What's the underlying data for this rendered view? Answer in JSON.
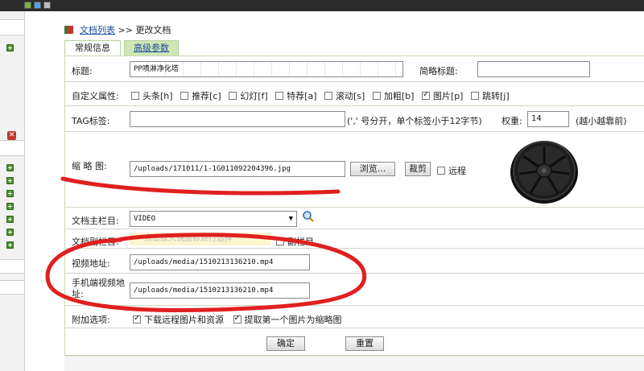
{
  "breadcrumb": {
    "link": "文档列表",
    "separator": ">>",
    "current": "更改文档"
  },
  "tabs": [
    {
      "label": "常规信息"
    },
    {
      "label": "高级参数"
    }
  ],
  "form": {
    "title": {
      "label": "标题:",
      "value": "PP喷淋净化塔"
    },
    "short_title": {
      "label": "简略标题:",
      "value": ""
    },
    "attributes": {
      "label": "自定义属性:",
      "items": [
        {
          "label": "头条[h]",
          "checked": false
        },
        {
          "label": "推荐[c]",
          "checked": false
        },
        {
          "label": "幻灯[f]",
          "checked": false
        },
        {
          "label": "特荐[a]",
          "checked": false
        },
        {
          "label": "滚动[s]",
          "checked": false
        },
        {
          "label": "加粗[b]",
          "checked": false
        },
        {
          "label": "图片[p]",
          "checked": true
        },
        {
          "label": "跳转[j]",
          "checked": false
        }
      ]
    },
    "tags": {
      "label": "TAG标签:",
      "value": "",
      "hint": "(',' 号分开，单个标签小于12字节)"
    },
    "weight": {
      "label": "权重:",
      "value": "14",
      "hint": "(越小越靠前)"
    },
    "thumbnail": {
      "label": "缩 略 图:",
      "value": "/uploads/171011/1-1G011092204396.jpg",
      "browse_label": "浏览...",
      "crop_label": "裁剪",
      "remote_label": "远程"
    },
    "main_column": {
      "label": "文档主栏目:",
      "value": "VIDEO"
    },
    "sub_column": {
      "label": "文档副栏目:",
      "placeholder": "点击放大镜图标进行选择",
      "button_label": "副栏目"
    },
    "video_url": {
      "label": "视频地址:",
      "value": "/uploads/media/1510213136210.mp4"
    },
    "mobile_video_url": {
      "label_line1": "手机端视频地",
      "label_line2": "址:",
      "value": "/uploads/media/1510213136210.mp4"
    },
    "extra_options": {
      "label": "附加选项:",
      "items": [
        {
          "label": "下载远程图片和资源",
          "checked": true
        },
        {
          "label": "提取第一个图片为缩略图",
          "checked": true
        }
      ]
    }
  },
  "buttons": {
    "confirm": "确定",
    "reset": "重置"
  },
  "colors": {
    "annotation": "#e02020",
    "tab_active": "#cfe6b5",
    "link": "#1a4c9c"
  },
  "icons": {
    "breadcrumb": "book-icon",
    "search": "magnifier-icon",
    "dropdown": "triangle-down-icon",
    "sidebar": "green-plus-icon"
  }
}
